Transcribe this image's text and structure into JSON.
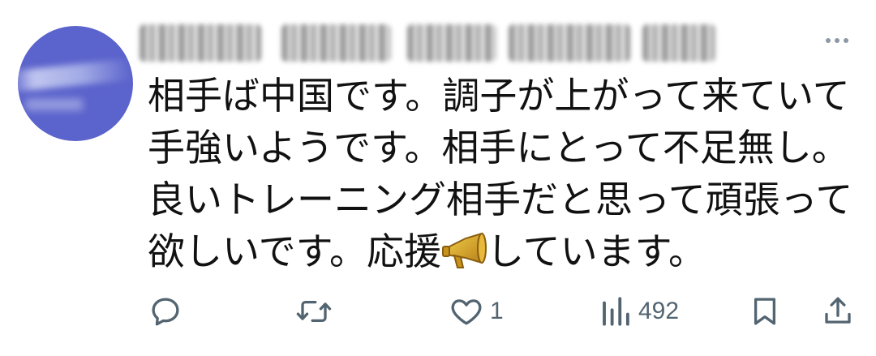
{
  "tweet": {
    "text_lines": [
      "相手ば中国です。調子が上がって来ていて",
      "手強いようです。相手にとって不足無し。",
      "良いトレーニング相手だと思って頑張って"
    ],
    "last_line_before": "欲しいです。応援",
    "last_line_after": "しています。"
  },
  "actions": {
    "reply_count": "",
    "retweet_count": "",
    "like_count": "1",
    "views_count": "492"
  },
  "icons": {
    "avatar": "avatar-blurred",
    "more": "more-horizontal-icon",
    "reply": "reply-icon",
    "retweet": "retweet-icon",
    "like": "heart-icon",
    "views": "views-chart-icon",
    "bookmark": "bookmark-icon",
    "share": "share-icon",
    "emoji": "megaphone-icon"
  },
  "colors": {
    "text": "#111111",
    "muted": "#536471",
    "avatar": "#5b63cc",
    "megaphone": "#d4a52a"
  }
}
